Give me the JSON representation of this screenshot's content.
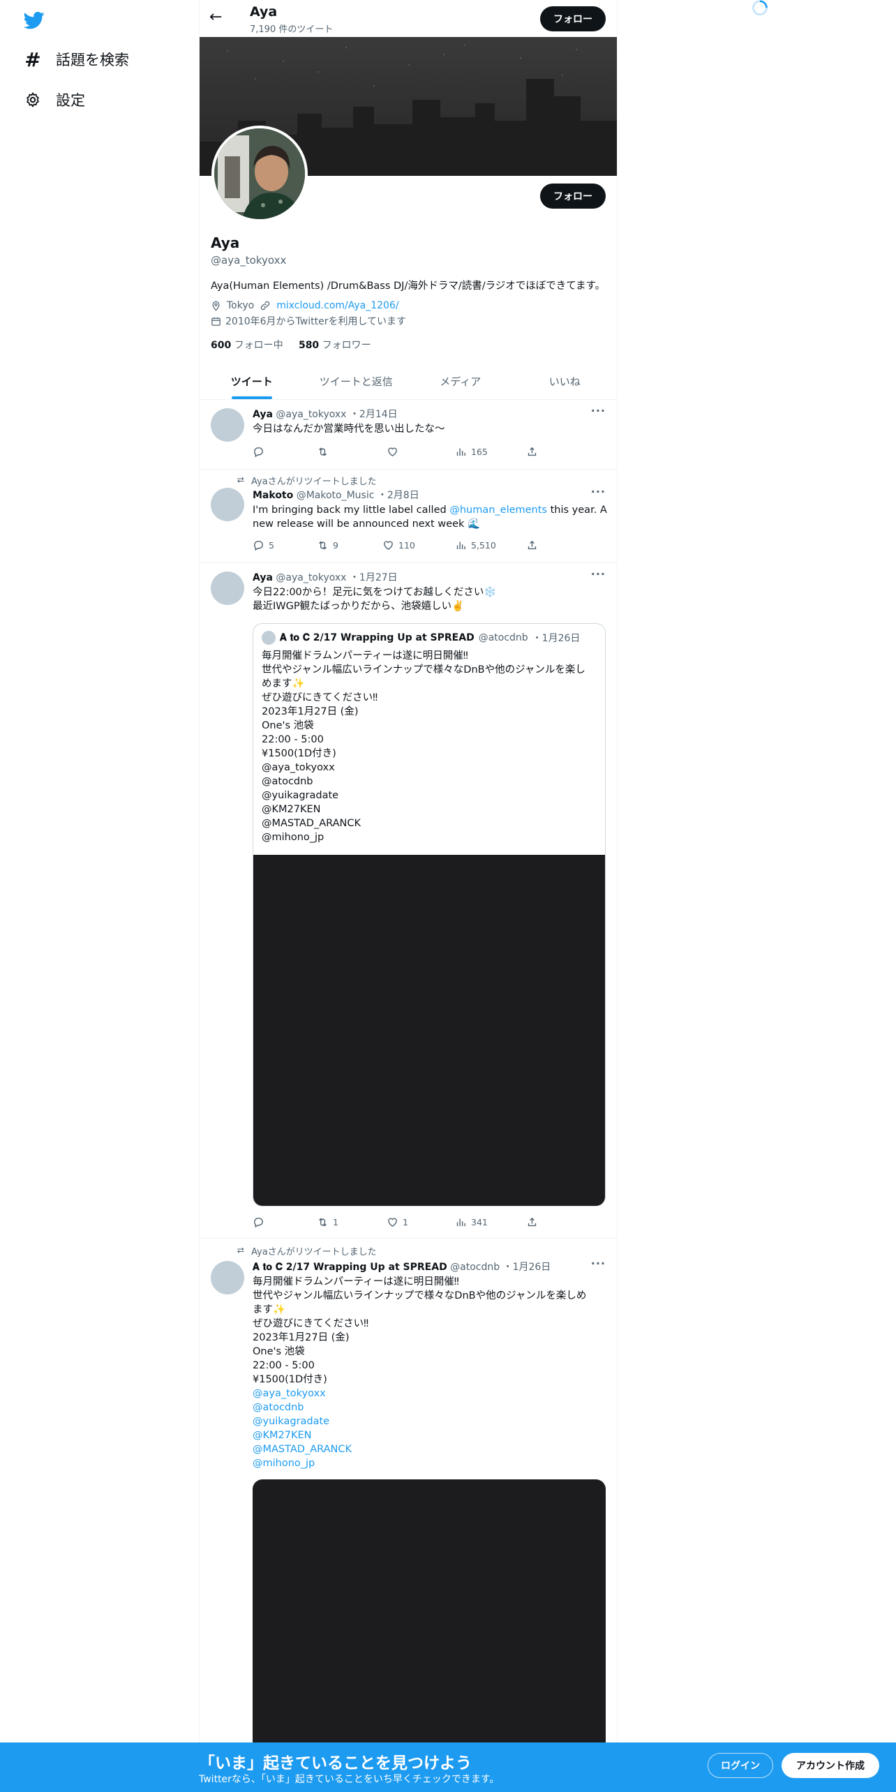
{
  "nav": {
    "explore_label": "話題を検索",
    "settings_label": "設定"
  },
  "header": {
    "name": "Aya",
    "tweet_count": "7,190 件のツイート",
    "follow_label": "フォロー"
  },
  "profile": {
    "name": "Aya",
    "handle": "@aya_tokyoxx",
    "bio": "Aya(Human Elements) /Drum&Bass DJ/海外ドラマ/読書/ラジオでほぼできてます。",
    "location": "Tokyo",
    "website": "mixcloud.com/Aya_1206/",
    "joined": "2010年6月からTwitterを利用しています",
    "following_count": "600",
    "following_label": "フォロー中",
    "followers_count": "580",
    "followers_label": "フォロワー",
    "follow_label": "フォロー"
  },
  "tabs": [
    {
      "label": "ツイート"
    },
    {
      "label": "ツイートと返信"
    },
    {
      "label": "メディア"
    },
    {
      "label": "いいね"
    }
  ],
  "tweets": [
    {
      "name": "Aya",
      "handle": "@aya_tokyoxx",
      "date": "・2月14日",
      "text": "今日はなんだか営業時代を思い出したな〜",
      "replies": "",
      "retweets": "",
      "likes": "",
      "views": "165"
    },
    {
      "retweet_label": "Ayaさんがリツイートしました",
      "name": "Makoto",
      "handle": "@Makoto_Music",
      "date": "・2月8日",
      "text_before": "I'm bringing back my little label called ",
      "mention": "@human_elements",
      "text_after": " this year. A new release will be announced next week 🌊",
      "replies": "5",
      "retweets": "9",
      "likes": "110",
      "views": "5,510"
    },
    {
      "name": "Aya",
      "handle": "@aya_tokyoxx",
      "date": "・1月27日",
      "line1": "今日22:00から！足元に気をつけてお越しください❄️",
      "line2": "最近IWGP観たばっかりだから、池袋嬉しい✌️",
      "quote": {
        "name": "𝐀 𝐭𝐨 𝐂 2/17 Wrapping Up at SPREAD",
        "handle": "@atocdnb",
        "date": "・1月26日",
        "lines": [
          "毎月開催ドラムンパーティーは遂に明日開催‼",
          "世代やジャンル幅広いラインナップで様々なDnBや他のジャンルを楽し",
          "めます✨",
          "ぜひ遊びにきてください‼",
          "2023年1月27日 (金)",
          "One's 池袋",
          "22:00 - 5:00",
          "¥1500(1D付き)",
          "@aya_tokyoxx",
          "@atocdnb",
          "@yuikagradate",
          "@KM27KEN",
          "@MASTAD_ARANCK",
          "@mihono_jp"
        ]
      },
      "replies": "",
      "retweets": "1",
      "likes": "1",
      "views": "341"
    },
    {
      "retweet_label": "Ayaさんがリツイートしました",
      "name": "𝐀 𝐭𝐨 𝐂 2/17 Wrapping Up at SPREAD",
      "handle": "@atocdnb",
      "date": "・1月26日",
      "lines": [
        "毎月開催ドラムンパーティーは遂に明日開催‼",
        "世代やジャンル幅広いラインナップで様々なDnBや他のジャンルを楽しめ",
        "ます✨",
        "ぜひ遊びにきてください‼",
        "2023年1月27日 (金)",
        "One's 池袋",
        "22:00 - 5:00",
        "¥1500(1D付き)"
      ],
      "mentions": [
        "@aya_tokyoxx",
        "@atocdnb",
        "@yuikagradate",
        "@KM27KEN",
        "@MASTAD_ARANCK",
        "@mihono_jp"
      ]
    }
  ],
  "bottom": {
    "title": "「いま」起きていることを見つけよう",
    "subtitle": "Twitterなら、「いま」起きていることをいち早くチェックできます。",
    "login_label": "ログイン",
    "signup_label": "アカウント作成"
  },
  "colors": {
    "accent": "#1d9bf0",
    "text": "#0f1419",
    "muted": "#536471"
  }
}
